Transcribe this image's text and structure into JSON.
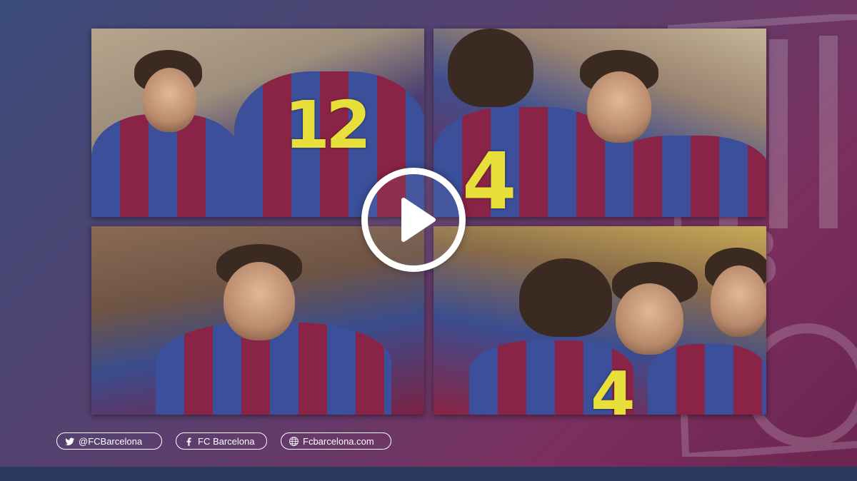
{
  "media": {
    "tiles": [
      {
        "label": "photo-young-player-with-teammate-12",
        "jersey_number": "12"
      },
      {
        "label": "photo-player-high-five-teammate-4",
        "jersey_number": "4"
      },
      {
        "label": "photo-player-smiling"
      },
      {
        "label": "photo-player-embrace-teammates",
        "jersey_number": "4"
      }
    ],
    "play_icon": "play-icon"
  },
  "social": {
    "twitter": {
      "icon": "twitter-icon",
      "label": "@FCBarcelona"
    },
    "facebook": {
      "icon": "facebook-icon",
      "label": "FC Barcelona"
    },
    "website": {
      "icon": "globe-icon",
      "label": "Fcbarcelona.com"
    }
  },
  "colors": {
    "blau": "#3b4f9a",
    "grana": "#8a2446",
    "number_yellow": "#e8df3a",
    "outline": "#ffffff"
  }
}
